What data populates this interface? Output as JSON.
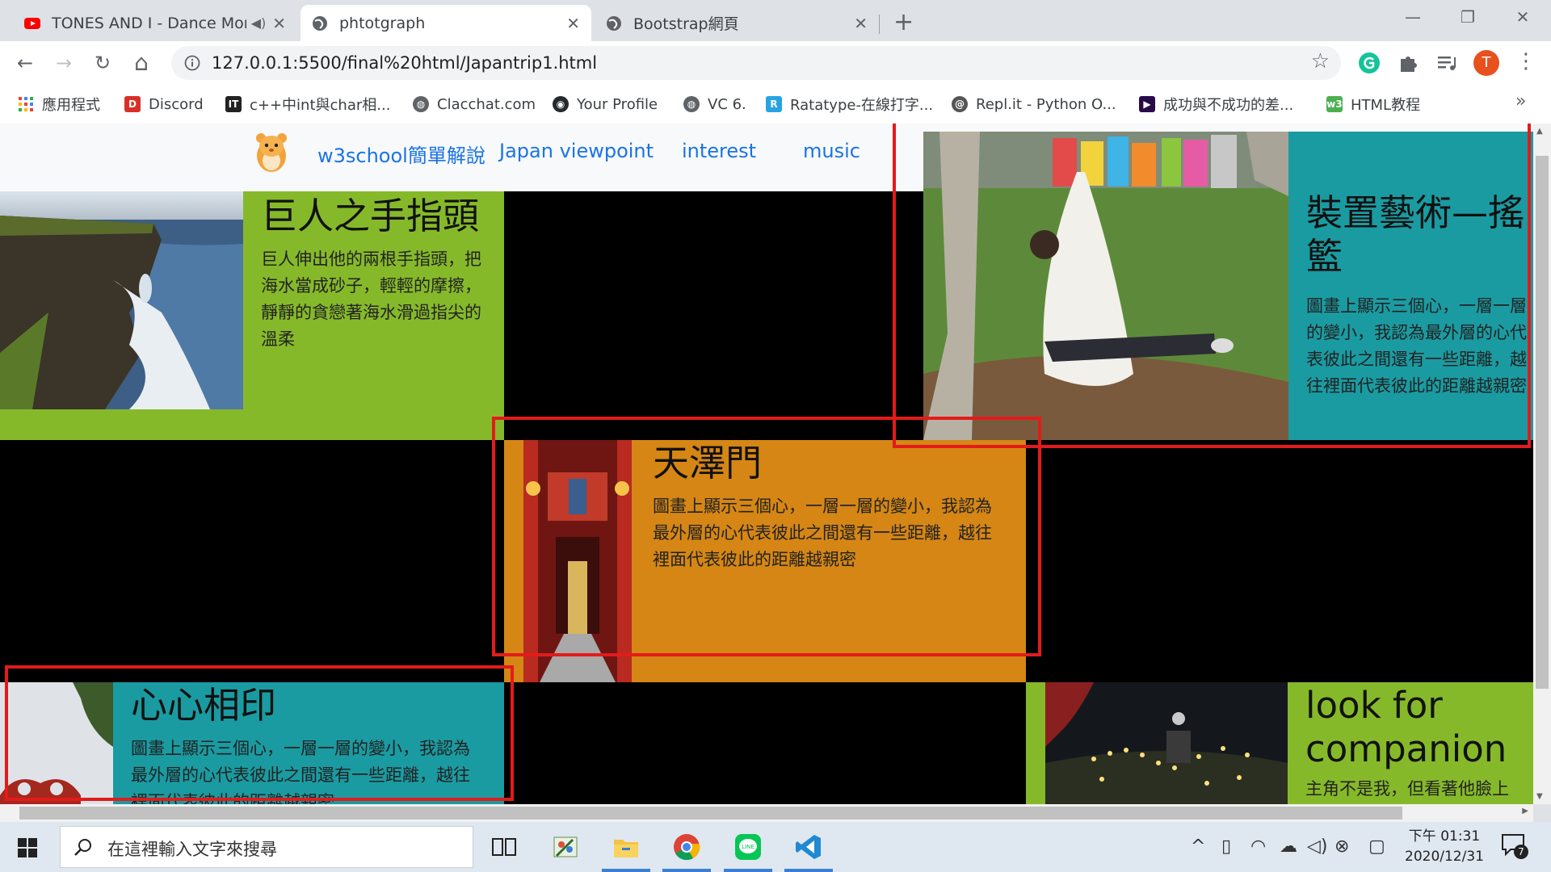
{
  "tabs": [
    {
      "title": "TONES AND I - Dance Mon",
      "audio": "speaker-icon",
      "close": "✕"
    },
    {
      "title": "phtotgraph",
      "close": "✕"
    },
    {
      "title": "Bootstrap網頁",
      "close": "✕"
    }
  ],
  "new_tab": "+",
  "window_controls": {
    "minimize": "—",
    "restore": "❐",
    "close": "✕"
  },
  "toolbar": {
    "url": "127.0.0.1:5500/final%20html/Japantrip1.html",
    "back": "←",
    "forward": "→",
    "reload": "↻",
    "home": "⌂",
    "star": "☆",
    "profile_initial": "T",
    "menu": "⋮"
  },
  "bookmarks": [
    {
      "label": "應用程式",
      "icon": "apps-grid-icon"
    },
    {
      "label": "Discord",
      "icon": "discord-icon"
    },
    {
      "label": "c++中int與char相...",
      "icon": "it-icon"
    },
    {
      "label": "Clacchat.com",
      "icon": "globe-icon"
    },
    {
      "label": "Your Profile",
      "icon": "github-icon"
    },
    {
      "label": "VC 6.",
      "icon": "globe-icon"
    },
    {
      "label": "Ratatype-在線打字...",
      "icon": "ratatype-icon"
    },
    {
      "label": "Repl.it - Python O...",
      "icon": "replit-icon"
    },
    {
      "label": "成功與不成功的差...",
      "icon": "video-icon"
    },
    {
      "label": "HTML教程",
      "icon": "w3-icon"
    }
  ],
  "bookmarks_more": "»",
  "page": {
    "nav": [
      "w3school簡單解說",
      "Japan viewpoint",
      "interest",
      "music"
    ],
    "cards": {
      "giant_hand": {
        "title": "巨人之手指頭",
        "text": "巨人伸出他的兩根手指頭，把海水當成砂子，輕輕的摩擦，靜靜的貪戀著海水滑過指尖的溫柔"
      },
      "installation": {
        "title": "裝置藝術—搖籃",
        "text": "圖畫上顯示三個心，一層一層的變小，我認為最外層的心代表彼此之間還有一些距離，越往裡面代表彼此的距離越親密"
      },
      "gate": {
        "title": "天澤門",
        "text": "圖畫上顯示三個心，一層一層的變小，我認為最外層的心代表彼此之間還有一些距離，越往裡面代表彼此的距離越親密"
      },
      "heart": {
        "title": "心心相印",
        "text": "圖畫上顯示三個心，一層一層的變小，我認為最外層的心代表彼此之間還有一些距離，越往裡面代表彼此的距離越親密"
      },
      "companion": {
        "title": "look for companion",
        "text": "主角不是我，但看著他臉上"
      }
    },
    "colors": {
      "green": "#86b92a",
      "teal": "#1a9ba1",
      "orange": "#d58614",
      "black": "#000000",
      "highlight": "#e31b1b"
    }
  },
  "taskbar": {
    "search_placeholder": "在這裡輸入文字來搜尋",
    "time": "下午 01:31",
    "date": "2020/12/31",
    "notification_count": "7"
  }
}
